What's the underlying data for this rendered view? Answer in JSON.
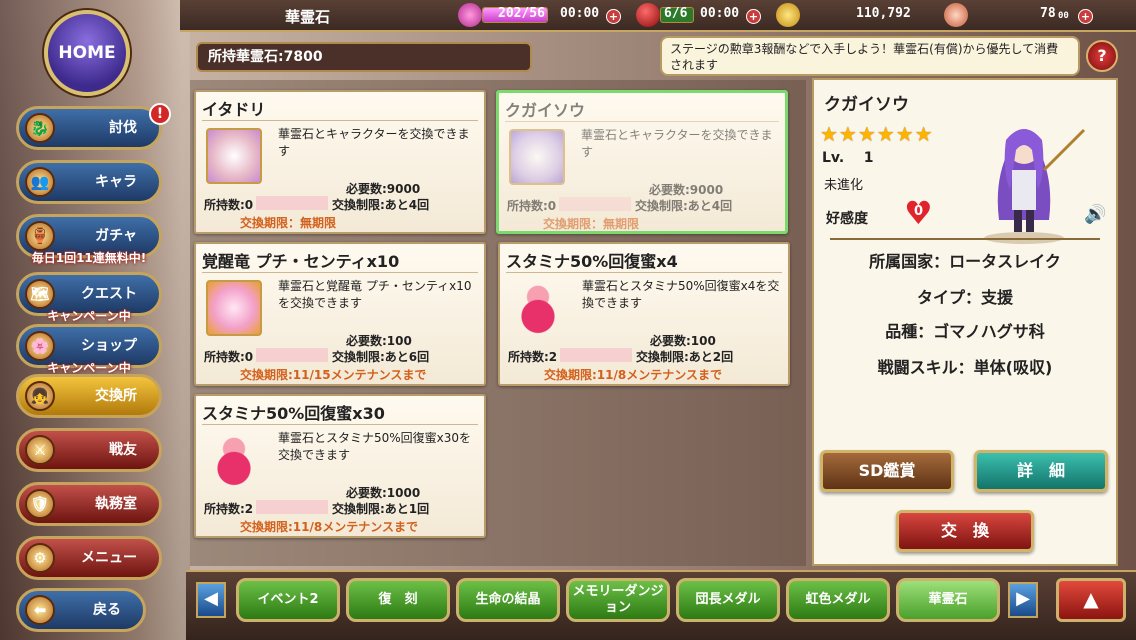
{
  "topbar": {
    "title": "華霊石",
    "stamina": "202/56",
    "stamina_fill": 1.0,
    "stamina_time": "00:00",
    "orbs": "6/6",
    "orbs_time": "00:00",
    "gold": "110,792",
    "gems": "78",
    "gems_suffix": "00",
    "plus": "+"
  },
  "sidebar": {
    "home": "HOME",
    "items": [
      {
        "label": "討伐",
        "banner": "",
        "alert": "!"
      },
      {
        "label": "キャラ",
        "banner": ""
      },
      {
        "label": "ガチャ",
        "banner": "毎日1回11連無料中!"
      },
      {
        "label": "クエスト",
        "banner": "キャンペーン中"
      },
      {
        "label": "ショップ",
        "banner": "キャンペーン中"
      },
      {
        "label": "交換所",
        "banner": ""
      },
      {
        "label": "戦友",
        "banner": ""
      },
      {
        "label": "執務室",
        "banner": ""
      },
      {
        "label": "メニュー",
        "banner": ""
      },
      {
        "label": "戻る",
        "banner": ""
      }
    ]
  },
  "owned": "所持華霊石:7800",
  "note": "ステージの勲章3報酬などで入手しよう！華霊石(有償)から優先して消費されます",
  "help": "?",
  "cards": [
    {
      "title": "イタドリ",
      "desc": "華霊石とキャラクターを交換できます",
      "req": "必要数:9000",
      "held": "所持数:0",
      "limit": "交換制限:あと4回",
      "expiry": "交換期限：無期限"
    },
    {
      "title": "クガイソウ",
      "desc": "華霊石とキャラクターを交換できます",
      "req": "必要数:9000",
      "held": "所持数:0",
      "limit": "交換制限:あと4回",
      "expiry": "交換期限：無期限"
    },
    {
      "title": "覚醒竜 プチ・センティx10",
      "desc": "華霊石と覚醒竜 プチ・センティx10を交換できます",
      "req": "必要数:100",
      "held": "所持数:0",
      "limit": "交換制限:あと6回",
      "expiry": "交換期限:11/15メンテナンスまで"
    },
    {
      "title": "スタミナ50%回復蜜x4",
      "desc": "華霊石とスタミナ50%回復蜜x4を交換できます",
      "req": "必要数:100",
      "held": "所持数:2",
      "limit": "交換制限:あと2回",
      "expiry": "交換期限:11/8メンテナンスまで"
    },
    {
      "title": "スタミナ50%回復蜜x30",
      "desc": "華霊石とスタミナ50%回復蜜x30を交換できます",
      "req": "必要数:1000",
      "held": "所持数:2",
      "limit": "交換制限:あと1回",
      "expiry": "交換期限:11/8メンテナンスまで"
    }
  ],
  "character": {
    "name": "クガイソウ",
    "stars": "★★★★★★",
    "lv_label": "Lv.",
    "lv": "1",
    "evolution": "未進化",
    "affinity_label": "好感度",
    "affinity": "0",
    "nation": "所属国家：ロータスレイク",
    "type": "タイプ：支援",
    "species": "品種：ゴマノハグサ科",
    "skill": "戦闘スキル：単体(吸収)",
    "sd_button": "SD鑑賞",
    "detail_button": "詳　細",
    "exchange_button": "交　換"
  },
  "tabs": [
    "イベント2",
    "復　刻",
    "生命の結晶",
    "メモリーダンジョン",
    "団長メダル",
    "虹色メダル",
    "華霊石"
  ],
  "active_tab": 6,
  "arrows": {
    "left": "◀",
    "right": "▶",
    "up": "▲"
  },
  "colors": {
    "accent_green": "#6cc046",
    "expiry_orange": "#d3601c",
    "selected_border": "#7bd96e"
  }
}
